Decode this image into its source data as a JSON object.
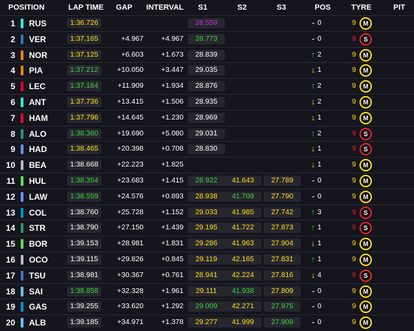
{
  "headers": {
    "position": "POSITION",
    "lap_time": "LAP TIME",
    "gap": "GAP",
    "interval": "INTERVAL",
    "s1": "S1",
    "s2": "S2",
    "s3": "S3",
    "pos": "POS",
    "tyre": "TYRE",
    "pit": "PIT"
  },
  "colors": {
    "green": "#3ed63e",
    "yellow": "#ffe017",
    "purple": "#c735e6",
    "red": "#e8232e",
    "background": "#15151e"
  },
  "rows": [
    {
      "pos": "1",
      "code": "RUS",
      "team_color": "#27f4d2",
      "lap": "1:36.726",
      "lap_c": "yellow",
      "gap": "",
      "int": "",
      "s1": "28.559",
      "s1_c": "purple",
      "s2": "",
      "s3": "",
      "arrow": "-",
      "arrow_c": "gray",
      "chg": "0",
      "laps": "9",
      "tyre": "M",
      "tyre_c": "#ffe017"
    },
    {
      "pos": "2",
      "code": "VER",
      "team_color": "#3671c6",
      "lap": "1:37.165",
      "lap_c": "yellow",
      "gap": "+4.967",
      "int": "+4.967",
      "s1": "28.773",
      "s1_c": "green",
      "s2": "",
      "s3": "",
      "arrow": "-",
      "arrow_c": "gray",
      "chg": "0",
      "laps": "9",
      "tyre": "S",
      "tyre_c": "#e8232e"
    },
    {
      "pos": "3",
      "code": "NOR",
      "team_color": "#ff8000",
      "lap": "1:37.125",
      "lap_c": "yellow",
      "gap": "+6.603",
      "int": "+1.673",
      "s1": "28.839",
      "s1_c": "white",
      "s2": "",
      "s3": "",
      "arrow": "↑",
      "arrow_c": "green",
      "chg": "2",
      "laps": "9",
      "tyre": "M",
      "tyre_c": "#ffe017"
    },
    {
      "pos": "4",
      "code": "PIA",
      "team_color": "#ff8000",
      "lap": "1:37.212",
      "lap_c": "green",
      "gap": "+10.050",
      "int": "+3.447",
      "s1": "29.035",
      "s1_c": "white",
      "s2": "",
      "s3": "",
      "arrow": "↓",
      "arrow_c": "yellow",
      "chg": "1",
      "laps": "9",
      "tyre": "M",
      "tyre_c": "#ffe017"
    },
    {
      "pos": "5",
      "code": "LEC",
      "team_color": "#e8002d",
      "lap": "1:37.184",
      "lap_c": "green",
      "gap": "+11.909",
      "int": "+1.934",
      "s1": "28.876",
      "s1_c": "white",
      "s2": "",
      "s3": "",
      "arrow": "↑",
      "arrow_c": "green",
      "chg": "2",
      "laps": "9",
      "tyre": "M",
      "tyre_c": "#ffe017"
    },
    {
      "pos": "6",
      "code": "ANT",
      "team_color": "#27f4d2",
      "lap": "1:37.736",
      "lap_c": "yellow",
      "gap": "+13.415",
      "int": "+1.506",
      "s1": "28.935",
      "s1_c": "white",
      "s2": "",
      "s3": "",
      "arrow": "↓",
      "arrow_c": "yellow",
      "chg": "2",
      "laps": "9",
      "tyre": "M",
      "tyre_c": "#ffe017"
    },
    {
      "pos": "7",
      "code": "HAM",
      "team_color": "#e8002d",
      "lap": "1:37.796",
      "lap_c": "yellow",
      "gap": "+14.645",
      "int": "+1.230",
      "s1": "28.969",
      "s1_c": "white",
      "s2": "",
      "s3": "",
      "arrow": "↓",
      "arrow_c": "yellow",
      "chg": "1",
      "laps": "9",
      "tyre": "M",
      "tyre_c": "#ffe017"
    },
    {
      "pos": "8",
      "code": "ALO",
      "team_color": "#229971",
      "lap": "1:38.360",
      "lap_c": "green",
      "gap": "+19.690",
      "int": "+5.080",
      "s1": "29.031",
      "s1_c": "white",
      "s2": "",
      "s3": "",
      "arrow": "↑",
      "arrow_c": "green",
      "chg": "2",
      "laps": "9",
      "tyre": "S",
      "tyre_c": "#e8232e"
    },
    {
      "pos": "9",
      "code": "HAD",
      "team_color": "#6692ff",
      "lap": "1:38.465",
      "lap_c": "yellow",
      "gap": "+20.398",
      "int": "+0.708",
      "s1": "28.830",
      "s1_c": "white",
      "s2": "",
      "s3": "",
      "arrow": "↓",
      "arrow_c": "yellow",
      "chg": "1",
      "laps": "9",
      "tyre": "S",
      "tyre_c": "#e8232e"
    },
    {
      "pos": "10",
      "code": "BEA",
      "team_color": "#b6babd",
      "lap": "1:38.668",
      "lap_c": "white",
      "gap": "+22.223",
      "int": "+1.825",
      "s1": "",
      "s1_c": "white",
      "s2": "",
      "s3": "",
      "arrow": "↓",
      "arrow_c": "yellow",
      "chg": "1",
      "laps": "9",
      "tyre": "M",
      "tyre_c": "#ffe017"
    },
    {
      "pos": "11",
      "code": "HUL",
      "team_color": "#52e252",
      "lap": "1:38.354",
      "lap_c": "green",
      "gap": "+23.683",
      "int": "+1.415",
      "s1": "28.922",
      "s1_c": "green",
      "s2": "41.643",
      "s2_c": "yellow",
      "s3": "27.789",
      "s3_c": "yellow",
      "arrow": "-",
      "arrow_c": "gray",
      "chg": "0",
      "laps": "9",
      "tyre": "M",
      "tyre_c": "#ffe017"
    },
    {
      "pos": "12",
      "code": "LAW",
      "team_color": "#6692ff",
      "lap": "1:38.559",
      "lap_c": "green",
      "gap": "+24.576",
      "int": "+0.893",
      "s1": "28.938",
      "s1_c": "yellow",
      "s2": "41.709",
      "s2_c": "green",
      "s3": "27.790",
      "s3_c": "yellow",
      "arrow": "-",
      "arrow_c": "gray",
      "chg": "0",
      "laps": "9",
      "tyre": "M",
      "tyre_c": "#ffe017"
    },
    {
      "pos": "13",
      "code": "COL",
      "team_color": "#0093cc",
      "lap": "1:38.760",
      "lap_c": "white",
      "gap": "+25.728",
      "int": "+1.152",
      "s1": "29.033",
      "s1_c": "yellow",
      "s2": "41.985",
      "s2_c": "yellow",
      "s3": "27.742",
      "s3_c": "yellow",
      "arrow": "↑",
      "arrow_c": "green",
      "chg": "3",
      "laps": "9",
      "tyre": "S",
      "tyre_c": "#e8232e"
    },
    {
      "pos": "14",
      "code": "STR",
      "team_color": "#229971",
      "lap": "1:38.790",
      "lap_c": "white",
      "gap": "+27.150",
      "int": "+1.439",
      "s1": "29.195",
      "s1_c": "yellow",
      "s2": "41.722",
      "s2_c": "yellow",
      "s3": "27.873",
      "s3_c": "yellow",
      "arrow": "↑",
      "arrow_c": "green",
      "chg": "1",
      "laps": "9",
      "tyre": "S",
      "tyre_c": "#e8232e"
    },
    {
      "pos": "15",
      "code": "BOR",
      "team_color": "#52e252",
      "lap": "1:39.153",
      "lap_c": "white",
      "gap": "+28.981",
      "int": "+1.831",
      "s1": "29.286",
      "s1_c": "yellow",
      "s2": "41.963",
      "s2_c": "yellow",
      "s3": "27.904",
      "s3_c": "yellow",
      "arrow": "↓",
      "arrow_c": "yellow",
      "chg": "1",
      "laps": "9",
      "tyre": "M",
      "tyre_c": "#ffe017"
    },
    {
      "pos": "16",
      "code": "OCO",
      "team_color": "#b6babd",
      "lap": "1:39.115",
      "lap_c": "white",
      "gap": "+29.826",
      "int": "+0.845",
      "s1": "29.119",
      "s1_c": "yellow",
      "s2": "42.165",
      "s2_c": "yellow",
      "s3": "27.831",
      "s3_c": "yellow",
      "arrow": "↑",
      "arrow_c": "green",
      "chg": "1",
      "laps": "9",
      "tyre": "M",
      "tyre_c": "#ffe017"
    },
    {
      "pos": "17",
      "code": "TSU",
      "team_color": "#3671c6",
      "lap": "1:38.981",
      "lap_c": "white",
      "gap": "+30.367",
      "int": "+0.761",
      "s1": "28.941",
      "s1_c": "yellow",
      "s2": "42.224",
      "s2_c": "yellow",
      "s3": "27.816",
      "s3_c": "yellow",
      "arrow": "↓",
      "arrow_c": "yellow",
      "chg": "4",
      "laps": "9",
      "tyre": "S",
      "tyre_c": "#e8232e"
    },
    {
      "pos": "18",
      "code": "SAI",
      "team_color": "#64c4ff",
      "lap": "1:38.858",
      "lap_c": "green",
      "gap": "+32.328",
      "int": "+1.961",
      "s1": "29.111",
      "s1_c": "yellow",
      "s2": "41.938",
      "s2_c": "green",
      "s3": "27.809",
      "s3_c": "yellow",
      "arrow": "-",
      "arrow_c": "gray",
      "chg": "0",
      "laps": "9",
      "tyre": "M",
      "tyre_c": "#ffe017"
    },
    {
      "pos": "19",
      "code": "GAS",
      "team_color": "#0093cc",
      "lap": "1:39.255",
      "lap_c": "white",
      "gap": "+33.620",
      "int": "+1.292",
      "s1": "29.009",
      "s1_c": "green",
      "s2": "42.271",
      "s2_c": "yellow",
      "s3": "27.975",
      "s3_c": "green",
      "arrow": "-",
      "arrow_c": "gray",
      "chg": "0",
      "laps": "9",
      "tyre": "M",
      "tyre_c": "#ffe017"
    },
    {
      "pos": "20",
      "code": "ALB",
      "team_color": "#64c4ff",
      "lap": "1:39.185",
      "lap_c": "white",
      "gap": "+34.971",
      "int": "+1.378",
      "s1": "29.277",
      "s1_c": "yellow",
      "s2": "41.999",
      "s2_c": "yellow",
      "s3": "27.909",
      "s3_c": "green",
      "arrow": "-",
      "arrow_c": "gray",
      "chg": "0",
      "laps": "9",
      "tyre": "M",
      "tyre_c": "#ffe017"
    }
  ]
}
